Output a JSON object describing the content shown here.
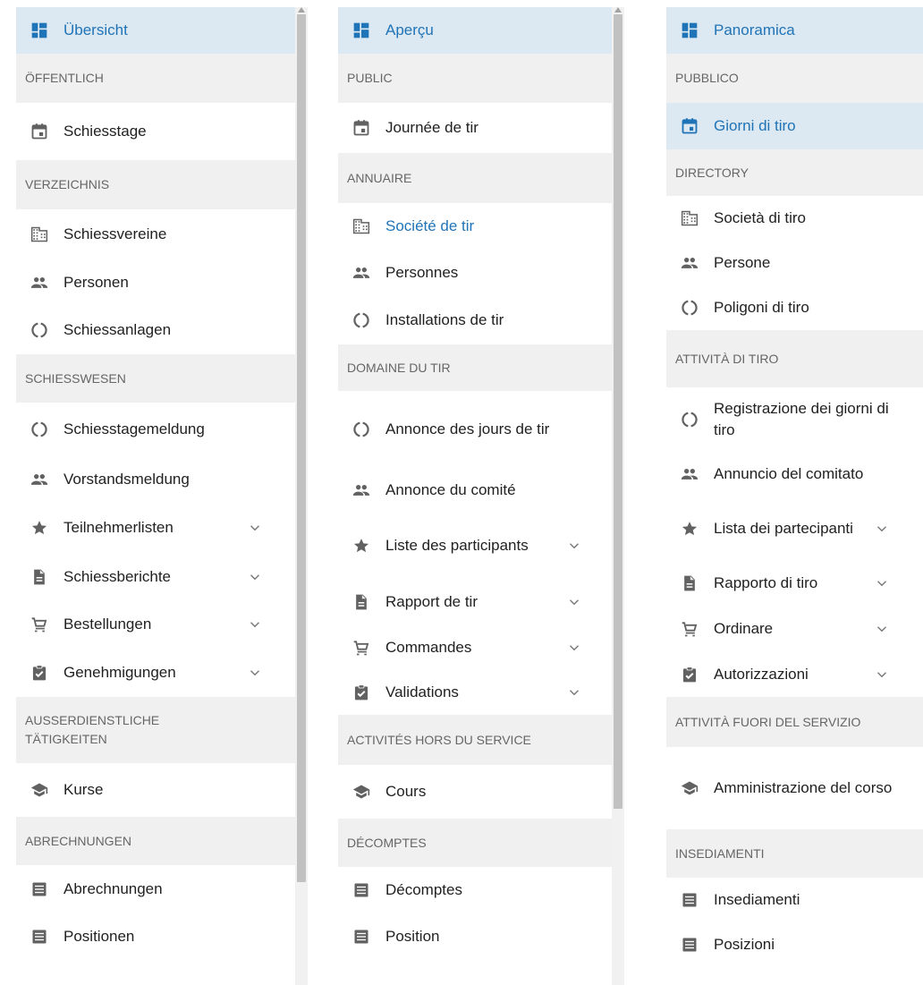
{
  "colors": {
    "accent": "#1f73b7",
    "active_bg": "#dce9f2",
    "header_bg": "#f0f0f0",
    "icon": "#616161"
  },
  "panels": [
    {
      "items": [
        {
          "kind": "item",
          "icon": "dashboard-icon",
          "label": "Übersicht",
          "active": true
        },
        {
          "kind": "header",
          "label": "ÖFFENTLICH"
        },
        {
          "kind": "item",
          "icon": "calendar-icon",
          "label": "Schiesstage"
        },
        {
          "kind": "header",
          "label": "VERZEICHNIS"
        },
        {
          "kind": "item",
          "icon": "building-icon",
          "label": "Schiessvereine"
        },
        {
          "kind": "item",
          "icon": "people-icon",
          "label": "Personen"
        },
        {
          "kind": "item",
          "icon": "target-icon",
          "label": "Schiessanlagen"
        },
        {
          "kind": "header",
          "label": "SCHIESSWESEN"
        },
        {
          "kind": "item",
          "icon": "target-icon",
          "label": "Schiesstagemeldung"
        },
        {
          "kind": "item",
          "icon": "people-icon",
          "label": "Vorstandsmeldung"
        },
        {
          "kind": "item",
          "icon": "star-icon",
          "label": "Teilnehmerlisten",
          "expand": true
        },
        {
          "kind": "item",
          "icon": "document-icon",
          "label": "Schiessberichte",
          "expand": true
        },
        {
          "kind": "item",
          "icon": "cart-icon",
          "label": "Bestellungen",
          "expand": true
        },
        {
          "kind": "item",
          "icon": "clipboard-check-icon",
          "label": "Genehmigungen",
          "expand": true
        },
        {
          "kind": "header",
          "label": "AUSSERDIENSTLICHE TÄTIGKEITEN"
        },
        {
          "kind": "item",
          "icon": "school-icon",
          "label": "Kurse"
        },
        {
          "kind": "header",
          "label": "ABRECHNUNGEN"
        },
        {
          "kind": "item",
          "icon": "list-icon",
          "label": "Abrechnungen"
        },
        {
          "kind": "item",
          "icon": "list-icon",
          "label": "Positionen"
        }
      ]
    },
    {
      "items": [
        {
          "kind": "item",
          "icon": "dashboard-icon",
          "label": "Aperçu",
          "active": true
        },
        {
          "kind": "header",
          "label": "PUBLIC"
        },
        {
          "kind": "item",
          "icon": "calendar-icon",
          "label": "Journée de tir"
        },
        {
          "kind": "header",
          "label": "ANNUAIRE"
        },
        {
          "kind": "item",
          "icon": "building-icon",
          "label": "Société de tir",
          "blue": true
        },
        {
          "kind": "item",
          "icon": "people-icon",
          "label": "Personnes"
        },
        {
          "kind": "item",
          "icon": "target-icon",
          "label": "Installations de tir"
        },
        {
          "kind": "header",
          "label": "DOMAINE DU TIR"
        },
        {
          "kind": "item",
          "icon": "target-icon",
          "label": "Annonce des jours de tir"
        },
        {
          "kind": "item",
          "icon": "people-icon",
          "label": "Annonce du comité"
        },
        {
          "kind": "item",
          "icon": "star-icon",
          "label": "Liste des participants",
          "expand": true
        },
        {
          "kind": "item",
          "icon": "document-icon",
          "label": "Rapport de tir",
          "expand": true
        },
        {
          "kind": "item",
          "icon": "cart-icon",
          "label": "Commandes",
          "expand": true
        },
        {
          "kind": "item",
          "icon": "clipboard-check-icon",
          "label": "Validations",
          "expand": true
        },
        {
          "kind": "header",
          "label": "ACTIVITÉS HORS DU SERVICE"
        },
        {
          "kind": "item",
          "icon": "school-icon",
          "label": "Cours"
        },
        {
          "kind": "header",
          "label": "DÉCOMPTES"
        },
        {
          "kind": "item",
          "icon": "list-icon",
          "label": "Décomptes"
        },
        {
          "kind": "item",
          "icon": "list-icon",
          "label": "Position"
        }
      ]
    },
    {
      "items": [
        {
          "kind": "item",
          "icon": "dashboard-icon",
          "label": "Panoramica",
          "active": true
        },
        {
          "kind": "header",
          "label": "PUBBLICO"
        },
        {
          "kind": "item",
          "icon": "calendar-icon",
          "label": "Giorni di tiro",
          "active": true
        },
        {
          "kind": "header",
          "label": "DIRECTORY"
        },
        {
          "kind": "item",
          "icon": "building-icon",
          "label": "Società di tiro"
        },
        {
          "kind": "item",
          "icon": "people-icon",
          "label": "Persone"
        },
        {
          "kind": "item",
          "icon": "target-icon",
          "label": "Poligoni di tiro"
        },
        {
          "kind": "header",
          "label": "ATTIVITÀ DI TIRO"
        },
        {
          "kind": "item",
          "icon": "target-icon",
          "label": "Registrazione dei giorni di tiro"
        },
        {
          "kind": "item",
          "icon": "people-icon",
          "label": "Annuncio del comitato"
        },
        {
          "kind": "item",
          "icon": "star-icon",
          "label": "Lista dei partecipanti",
          "expand": true
        },
        {
          "kind": "item",
          "icon": "document-icon",
          "label": "Rapporto di tiro",
          "expand": true
        },
        {
          "kind": "item",
          "icon": "cart-icon",
          "label": "Ordinare",
          "expand": true
        },
        {
          "kind": "item",
          "icon": "clipboard-check-icon",
          "label": "Autorizzazioni",
          "expand": true
        },
        {
          "kind": "header",
          "label": "ATTIVITÀ FUORI DEL SERVIZIO"
        },
        {
          "kind": "item",
          "icon": "school-icon",
          "label": "Amministrazione del corso"
        },
        {
          "kind": "header",
          "label": "INSEDIAMENTI"
        },
        {
          "kind": "item",
          "icon": "list-icon",
          "label": "Insediamenti"
        },
        {
          "kind": "item",
          "icon": "list-icon",
          "label": "Posizioni"
        }
      ]
    }
  ]
}
